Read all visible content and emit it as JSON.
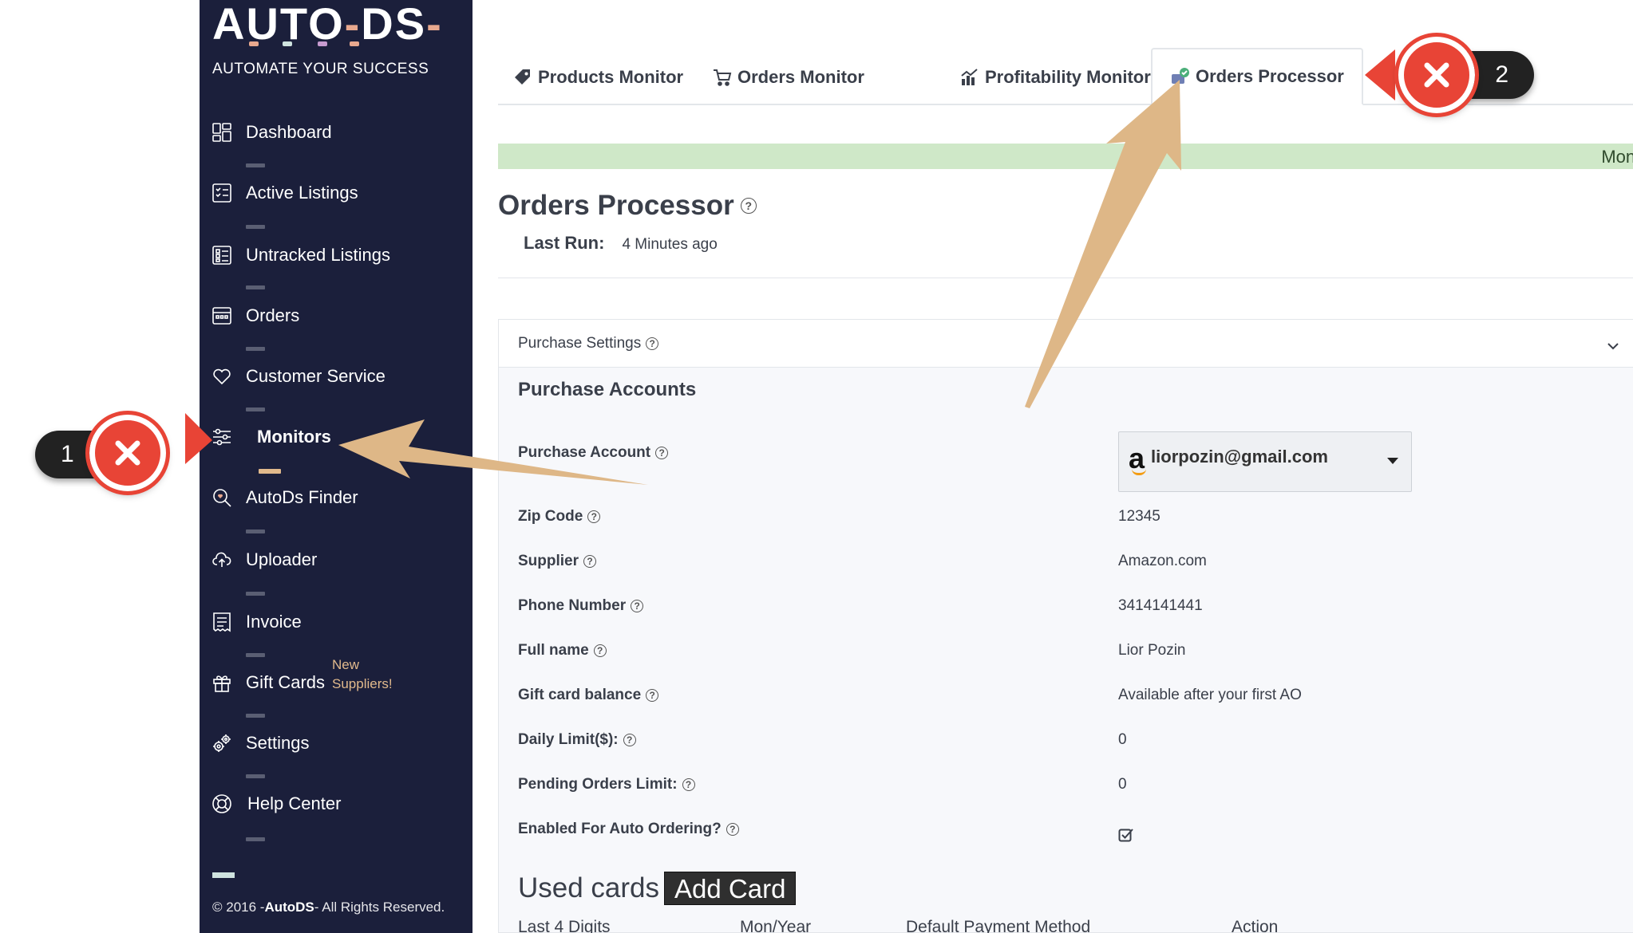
{
  "brand": {
    "logo": "AUTO-DS-",
    "tagline": "AUTOMATE YOUR SUCCESS",
    "colors": {
      "sidebar": "#1b1f3b",
      "accent": "#e1b98c",
      "banner": "#cfe8c8",
      "callout": "#e84436"
    }
  },
  "sidebar": {
    "items": [
      {
        "label": "Dashboard",
        "icon": "dashboard-icon"
      },
      {
        "label": "Active Listings",
        "icon": "listings-icon"
      },
      {
        "label": "Untracked Listings",
        "icon": "untracked-icon"
      },
      {
        "label": "Orders",
        "icon": "orders-icon"
      },
      {
        "label": "Customer Service",
        "icon": "heart-icon"
      },
      {
        "label": "Monitors",
        "icon": "sliders-icon",
        "active": true
      },
      {
        "label": "AutoDs Finder",
        "icon": "finder-icon"
      },
      {
        "label": "Uploader",
        "icon": "upload-cloud-icon"
      },
      {
        "label": "Invoice",
        "icon": "invoice-icon"
      },
      {
        "label": "Gift Cards",
        "icon": "gift-icon",
        "badge": "New Suppliers!"
      },
      {
        "label": "Settings",
        "icon": "gears-icon"
      },
      {
        "label": "Help Center",
        "icon": "lifebuoy-icon"
      }
    ],
    "footer_prefix": "© 2016 -",
    "footer_brand": "AutoDS",
    "footer_suffix": "- All Rights Reserved."
  },
  "tabs": [
    {
      "label": "Products Monitor",
      "icon": "tag-icon"
    },
    {
      "label": "Orders Monitor",
      "icon": "cart-icon"
    },
    {
      "label": "Profitability Monitor",
      "icon": "chart-icon"
    },
    {
      "label": "Orders Processor",
      "icon": "processor-icon",
      "active": true
    }
  ],
  "banner": {
    "text": "Moni"
  },
  "page": {
    "title": "Orders Processor",
    "last_run_label": "Last Run:",
    "last_run_value": "4 Minutes ago"
  },
  "purchase_settings": {
    "header": "Purchase Settings",
    "section_title": "Purchase Accounts",
    "account_label": "Purchase Account",
    "account_value": "liorpozin@gmail.com",
    "rows": [
      {
        "label": "Zip Code",
        "value": "12345"
      },
      {
        "label": "Supplier",
        "value": "Amazon.com"
      },
      {
        "label": "Phone Number",
        "value": "3414141441"
      },
      {
        "label": "Full name",
        "value": "Lior Pozin"
      },
      {
        "label": "Gift card balance",
        "value": "Available after your first AO"
      },
      {
        "label": "Daily Limit($):",
        "value": "0"
      },
      {
        "label": "Pending Orders Limit:",
        "value": "0"
      },
      {
        "label": "Enabled For Auto Ordering?",
        "value": ""
      }
    ],
    "auto_ordering_enabled": true
  },
  "used_cards": {
    "title": "Used cards",
    "add_button": "Add Card",
    "columns": [
      "Last 4 Digits",
      "Mon/Year",
      "Default Payment Method",
      "Action"
    ]
  },
  "annotations": [
    {
      "number": "1"
    },
    {
      "number": "2"
    }
  ]
}
